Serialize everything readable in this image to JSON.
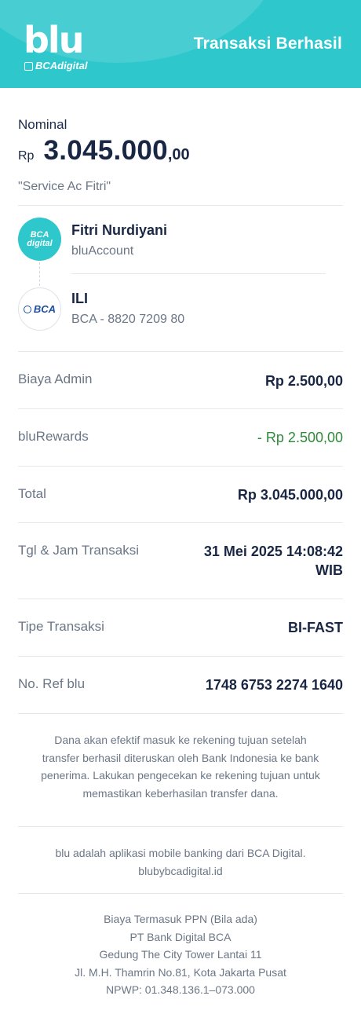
{
  "header": {
    "logo_word": "blu",
    "logo_sub": "BCAdigital",
    "title": "Transaksi Berhasil",
    "color": "#2ec7cc"
  },
  "nominal": {
    "label": "Nominal",
    "currency": "Rp",
    "amount": "3.045.000",
    "decimals": ",00",
    "note": "\"Service Ac Fitri\""
  },
  "sender": {
    "avatar_line1": "BCA",
    "avatar_line2": "digital",
    "name": "Fitri Nurdiyani",
    "account": "bluAccount"
  },
  "receiver": {
    "avatar_text": "BCA",
    "name": "ILI",
    "account": "BCA - 8820 7209 80"
  },
  "details": [
    {
      "label": "Biaya Admin",
      "value": "Rp 2.500,00"
    },
    {
      "label": "bluRewards",
      "value": "- Rp 2.500,00"
    },
    {
      "label": "Total",
      "value": "Rp 3.045.000,00"
    },
    {
      "label": "Tgl & Jam Transaksi",
      "value_line1": "31 Mei 2025 14:08:42",
      "value_line2": "WIB"
    },
    {
      "label": "Tipe Transaksi",
      "value": "BI-FAST"
    },
    {
      "label": "No. Ref blu",
      "value": "1748 6753 2274 1640"
    }
  ],
  "disclaimer": [
    "Dana akan efektif masuk ke rekening tujuan setelah",
    "transfer berhasil diteruskan oleh Bank Indonesia ke bank",
    "penerima. Lakukan pengecekan ke rekening tujuan untuk",
    "memastikan keberhasilan transfer dana."
  ],
  "about": [
    "blu adalah aplikasi mobile banking dari BCA Digital.",
    "blubybcadigital.id"
  ],
  "footer": [
    "Biaya Termasuk PPN (Bila ada)",
    "PT Bank Digital BCA",
    "Gedung The City Tower Lantai 11",
    "Jl. M.H. Thamrin No.81, Kota Jakarta Pusat",
    "NPWP: 01.348.136.1–073.000"
  ],
  "colors": {
    "positive": "#2e8a3a",
    "muted": "#6b7686",
    "primary_text": "#1a2744"
  }
}
